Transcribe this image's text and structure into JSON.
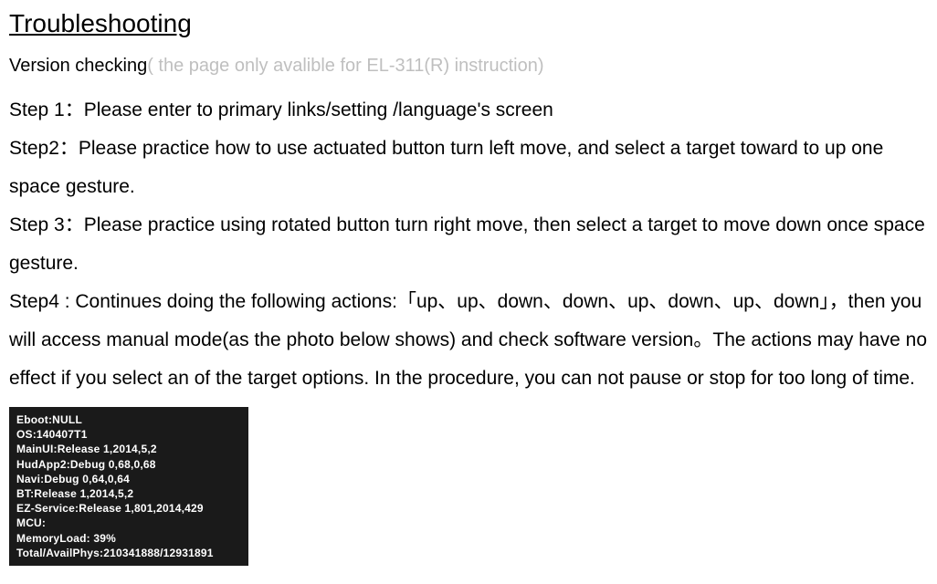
{
  "title": "Troubleshooting  ",
  "version": {
    "label": "Version checking",
    "note": "( the page only avalible for EL-311(R) instruction)"
  },
  "paragraphs": {
    "p1": "Step 1：Please enter to primary links/setting /language's screen",
    "p2": "Step2：Please practice how to use actuated button turn left move, and select a target toward to up one space gesture.",
    "p3": "Step 3：Please practice using rotated button turn right move, then select a target to move down once space gesture.",
    "p4": "Step4 : Continues doing the following actions:「up、up、down、down、up、down、up、down」，then you will access manual mode(as the photo below shows) and check software version。The actions may have no effect if you select an of the target options. In the procedure, you can not pause or stop for too long of time."
  },
  "screenshot_lines": {
    "l0": "Eboot:NULL",
    "l1": "OS:140407T1",
    "l2": "MainUI:Release 1,2014,5,2",
    "l3": "HudApp2:Debug 0,68,0,68",
    "l4": "Navi:Debug 0,64,0,64",
    "l5": "BT:Release 1,2014,5,2",
    "l6": "EZ-Service:Release 1,801,2014,429",
    "l7": "MCU:",
    "l8": "MemoryLoad: 39%",
    "l9": "Total/AvailPhys:210341888/12931891"
  }
}
